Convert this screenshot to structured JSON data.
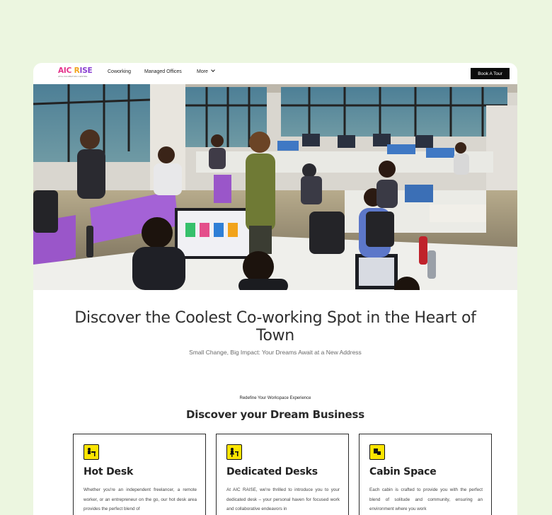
{
  "brand": {
    "logo_part1": "AIC",
    "logo_part2": " R",
    "logo_part3": "ISE",
    "tagline": "ATAL INCUBATION CENTRE"
  },
  "nav": {
    "links": [
      "Coworking",
      "Managed Offices"
    ],
    "more_label": "More",
    "cta_label": "Book A Tour"
  },
  "hero": {
    "headline": "Discover the Coolest Co-working Spot in the Heart of Town",
    "subheadline": "Small Change, Big Impact: Your Dreams Await at a New Address"
  },
  "section": {
    "eyebrow": "Redefine Your Workspace Experience",
    "title": "Discover your Dream Business"
  },
  "features": [
    {
      "icon": "desk-icon",
      "title": "Hot Desk",
      "text": "Whether you're an independent freelancer, a remote worker, or an entrepreneur on the go, our hot desk area provides the perfect blend of"
    },
    {
      "icon": "desk-chair-icon",
      "title": "Dedicated Desks",
      "text": "At AIC RAISE, we're thrilled to introduce you to your dedicated desk – your personal haven for focused work and collaborative endeavors in"
    },
    {
      "icon": "cabin-icon",
      "title": "Cabin Space",
      "text": "Each cabin is crafted to provide you with the perfect blend of solitude and community, ensuring an environment where you work"
    }
  ],
  "colors": {
    "page_bg": "#ecf6e0",
    "accent_yellow": "#fbe400",
    "cta_bg": "#0c0c0c"
  }
}
